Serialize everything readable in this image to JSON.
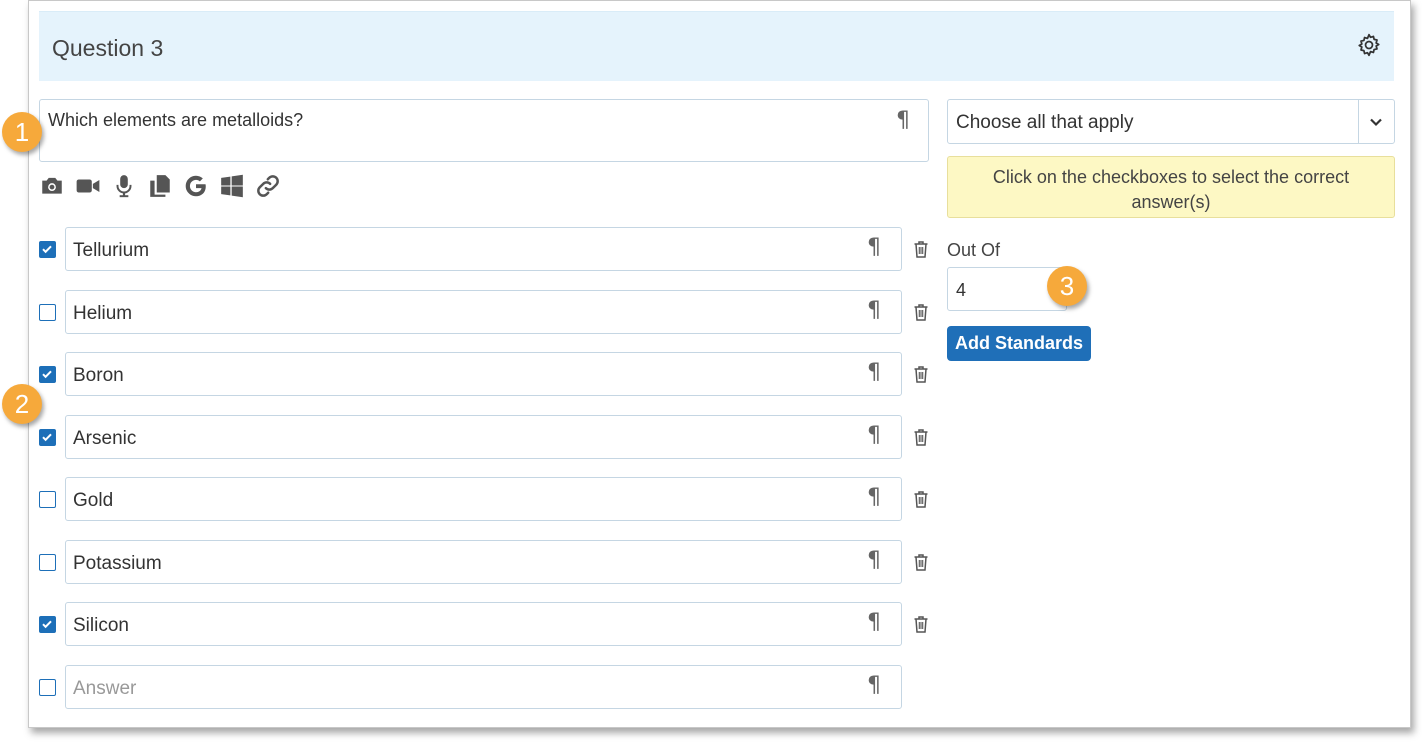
{
  "question": {
    "title": "Question 3",
    "text": "Which elements are metalloids?",
    "pilcrow": "¶"
  },
  "toolbar": {
    "icons": [
      "camera-icon",
      "video-icon",
      "microphone-icon",
      "copy-icon",
      "google-icon",
      "windows-icon",
      "link-icon"
    ]
  },
  "answers": [
    {
      "label": "Tellurium",
      "checked": true
    },
    {
      "label": "Helium",
      "checked": false
    },
    {
      "label": "Boron",
      "checked": true
    },
    {
      "label": "Arsenic",
      "checked": true
    },
    {
      "label": "Gold",
      "checked": false
    },
    {
      "label": "Potassium",
      "checked": false
    },
    {
      "label": "Silicon",
      "checked": true
    }
  ],
  "new_answer": {
    "placeholder": "Answer",
    "checked": false
  },
  "settings": {
    "question_type": "Choose all that apply",
    "hint": "Click on the checkboxes to select the correct answer(s)",
    "out_of_label": "Out Of",
    "out_of_value": "4",
    "add_standards_label": "Add Standards"
  },
  "callouts": [
    "1",
    "2",
    "3"
  ],
  "colors": {
    "header_bg": "#e5f3fc",
    "accent": "#1f6fb8",
    "hint_bg": "#fdf8c4",
    "callout": "#f6a93b"
  }
}
